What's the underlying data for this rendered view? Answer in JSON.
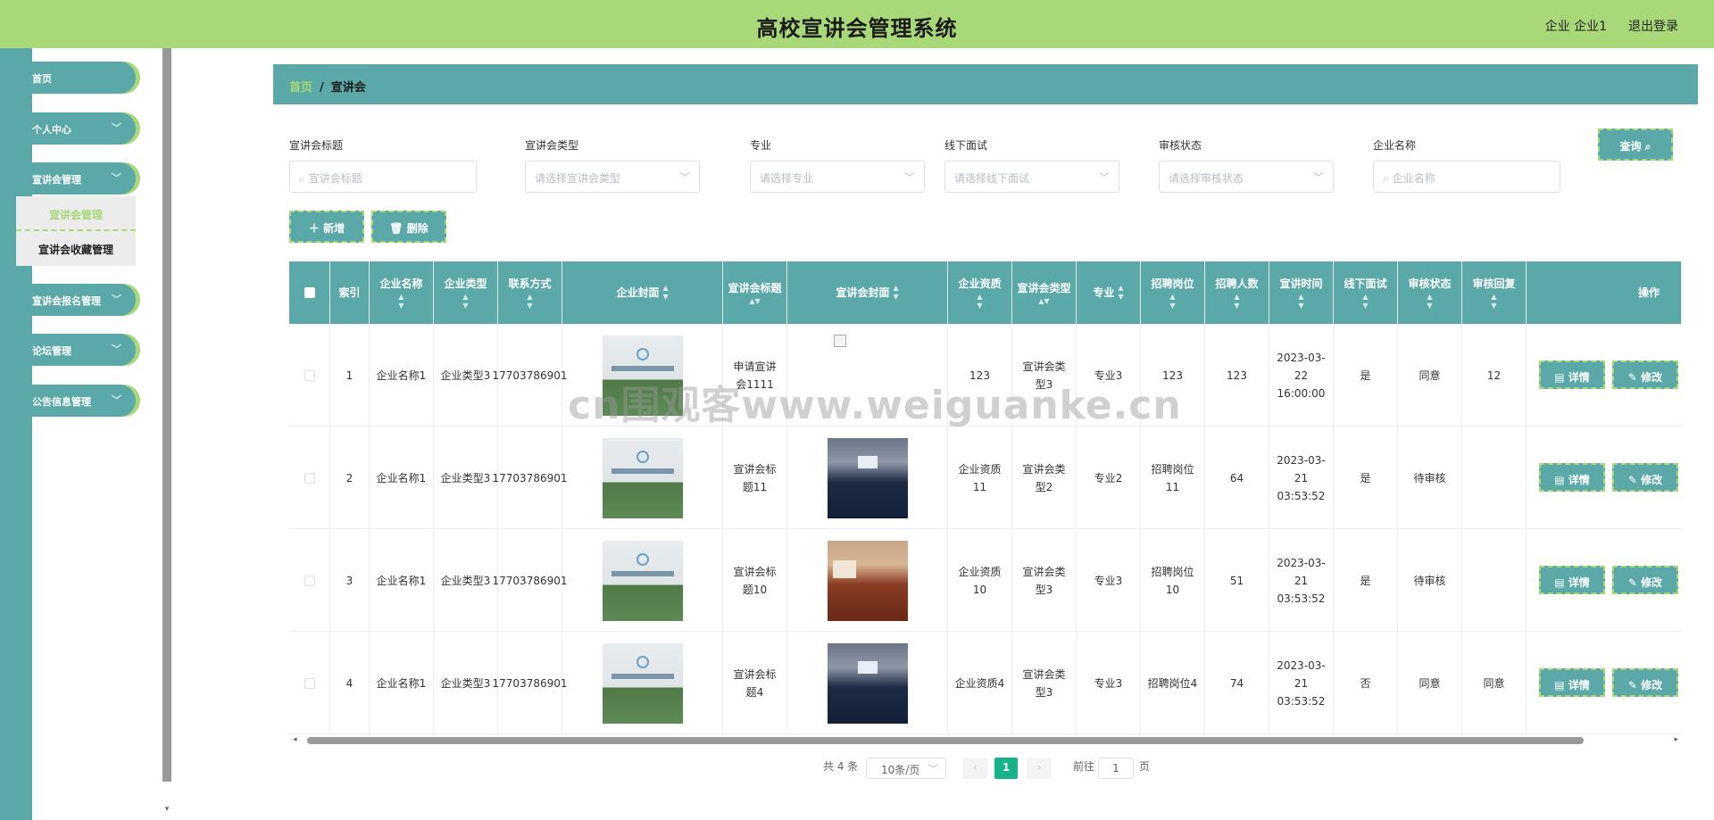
{
  "header": {
    "title": "高校宣讲会管理系统",
    "user": "企业 企业1",
    "logout": "退出登录"
  },
  "sidebar": {
    "items": [
      {
        "label": "首页"
      },
      {
        "label": "个人中心"
      },
      {
        "label": "宣讲会管理"
      },
      {
        "label": "宣讲会报名管理"
      },
      {
        "label": "论坛管理"
      },
      {
        "label": "公告信息管理"
      }
    ],
    "submenu": [
      {
        "label": "宣讲会管理",
        "active": true
      },
      {
        "label": "宣讲会收藏管理",
        "active": false
      }
    ]
  },
  "breadcrumb": {
    "home": "首页",
    "separator": "/",
    "current": "宣讲会"
  },
  "filters": {
    "title": {
      "label": "宣讲会标题",
      "placeholder": "宣讲会标题"
    },
    "type": {
      "label": "宣讲会类型",
      "placeholder": "请选择宣讲会类型"
    },
    "major": {
      "label": "专业",
      "placeholder": "请选择专业"
    },
    "offline": {
      "label": "线下面试",
      "placeholder": "请选择线下面试"
    },
    "audit": {
      "label": "审核状态",
      "placeholder": "请选择审核状态"
    },
    "company": {
      "label": "企业名称",
      "placeholder": "企业名称"
    },
    "search_button": "查询"
  },
  "actions": {
    "add": "新增",
    "delete": "删除"
  },
  "table": {
    "headers": [
      "索引",
      "企业名称",
      "企业类型",
      "联系方式",
      "企业封面",
      "宣讲会标题",
      "宣讲会封面",
      "企业资质",
      "宣讲会类型",
      "专业",
      "招聘岗位",
      "招聘人数",
      "宣讲时间",
      "线下面试",
      "审核状态",
      "审核回复",
      "操作"
    ],
    "rows": [
      {
        "index": "1",
        "company": "企业名称1",
        "ctype": "企业类型3",
        "phone": "17703786901",
        "title": "申请宣讲会1111",
        "qual": "123",
        "stype": "宣讲会类型3",
        "major": "专业3",
        "post": "123",
        "count": "123",
        "time": "2023-03-22 16:00:00",
        "offline": "是",
        "audit": "同意",
        "reply": "12",
        "cover": "broken"
      },
      {
        "index": "2",
        "company": "企业名称1",
        "ctype": "企业类型3",
        "phone": "17703786901",
        "title": "宣讲会标题11",
        "qual": "企业资质11",
        "stype": "宣讲会类型2",
        "major": "专业2",
        "post": "招聘岗位11",
        "count": "64",
        "time": "2023-03-21 03:53:52",
        "offline": "是",
        "audit": "待审核",
        "reply": "",
        "cover": "blue"
      },
      {
        "index": "3",
        "company": "企业名称1",
        "ctype": "企业类型3",
        "phone": "17703786901",
        "title": "宣讲会标题10",
        "qual": "企业资质10",
        "stype": "宣讲会类型3",
        "major": "专业3",
        "post": "招聘岗位10",
        "count": "51",
        "time": "2023-03-21 03:53:52",
        "offline": "是",
        "audit": "待审核",
        "reply": "",
        "cover": "red"
      },
      {
        "index": "4",
        "company": "企业名称1",
        "ctype": "企业类型3",
        "phone": "17703786901",
        "title": "宣讲会标题4",
        "qual": "企业资质4",
        "stype": "宣讲会类型3",
        "major": "专业3",
        "post": "招聘岗位4",
        "count": "74",
        "time": "2023-03-21 03:53:52",
        "offline": "否",
        "audit": "同意",
        "reply": "同意",
        "cover": "blue"
      }
    ],
    "row_actions": {
      "detail": "详情",
      "edit": "修改"
    }
  },
  "pagination": {
    "total": "共 4 条",
    "page_size": "10条/页",
    "current": "1",
    "goto_prefix": "前往",
    "goto_value": "1",
    "goto_suffix": "页"
  },
  "watermark": "cn围观客www.weiguanke.cn",
  "colors": {
    "teal": "#5aa9a8",
    "green": "#a8d878",
    "pager_active": "#19b38a"
  }
}
